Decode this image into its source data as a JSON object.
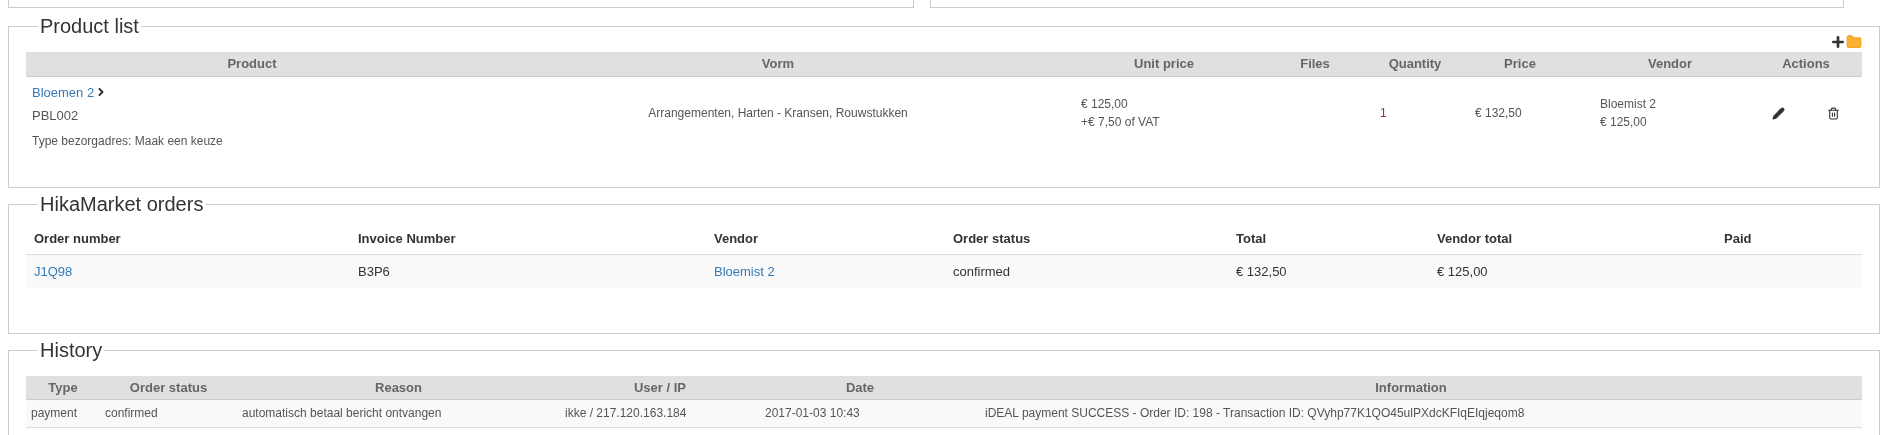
{
  "product_list": {
    "legend": "Product list",
    "columns": [
      "Product",
      "Vorm",
      "Unit price",
      "Files",
      "Quantity",
      "Price",
      "Vendor",
      "Actions"
    ],
    "rows": [
      {
        "product_name": "Bloemen 2",
        "code": "PBL002",
        "delivery_type": "Type bezorgadres: Maak een keuze",
        "vorm": "Arrangementen, Harten - Kransen, Rouwstukken",
        "unit_price": "€ 125,00",
        "vat": "+€ 7,50 of VAT",
        "quantity": "1",
        "price": "€ 132,50",
        "vendor_name": "Bloemist 2",
        "vendor_price": "€ 125,00"
      }
    ]
  },
  "hikamarket_orders": {
    "legend": "HikaMarket orders",
    "columns": [
      "Order number",
      "Invoice Number",
      "Vendor",
      "Order status",
      "Total",
      "Vendor total",
      "Paid"
    ],
    "rows": [
      {
        "order_number": "J1Q98",
        "invoice_number": "B3P6",
        "vendor": "Bloemist 2",
        "order_status": "confirmed",
        "total": "€ 132,50",
        "vendor_total": "€ 125,00"
      }
    ]
  },
  "history": {
    "legend": "History",
    "columns": [
      "Type",
      "Order status",
      "Reason",
      "User / IP",
      "Date",
      "Information"
    ],
    "rows": [
      {
        "type": "payment",
        "order_status": "confirmed",
        "reason": "automatisch betaal bericht ontvangen",
        "user_ip": "ikke / 217.120.163.184",
        "date": "2017-01-03 10:43",
        "information": "iDEAL payment SUCCESS - Order ID: 198 - Transaction ID: QVyhp77K1QO45ulPXdcKFIqEIqjeqom8"
      }
    ]
  }
}
